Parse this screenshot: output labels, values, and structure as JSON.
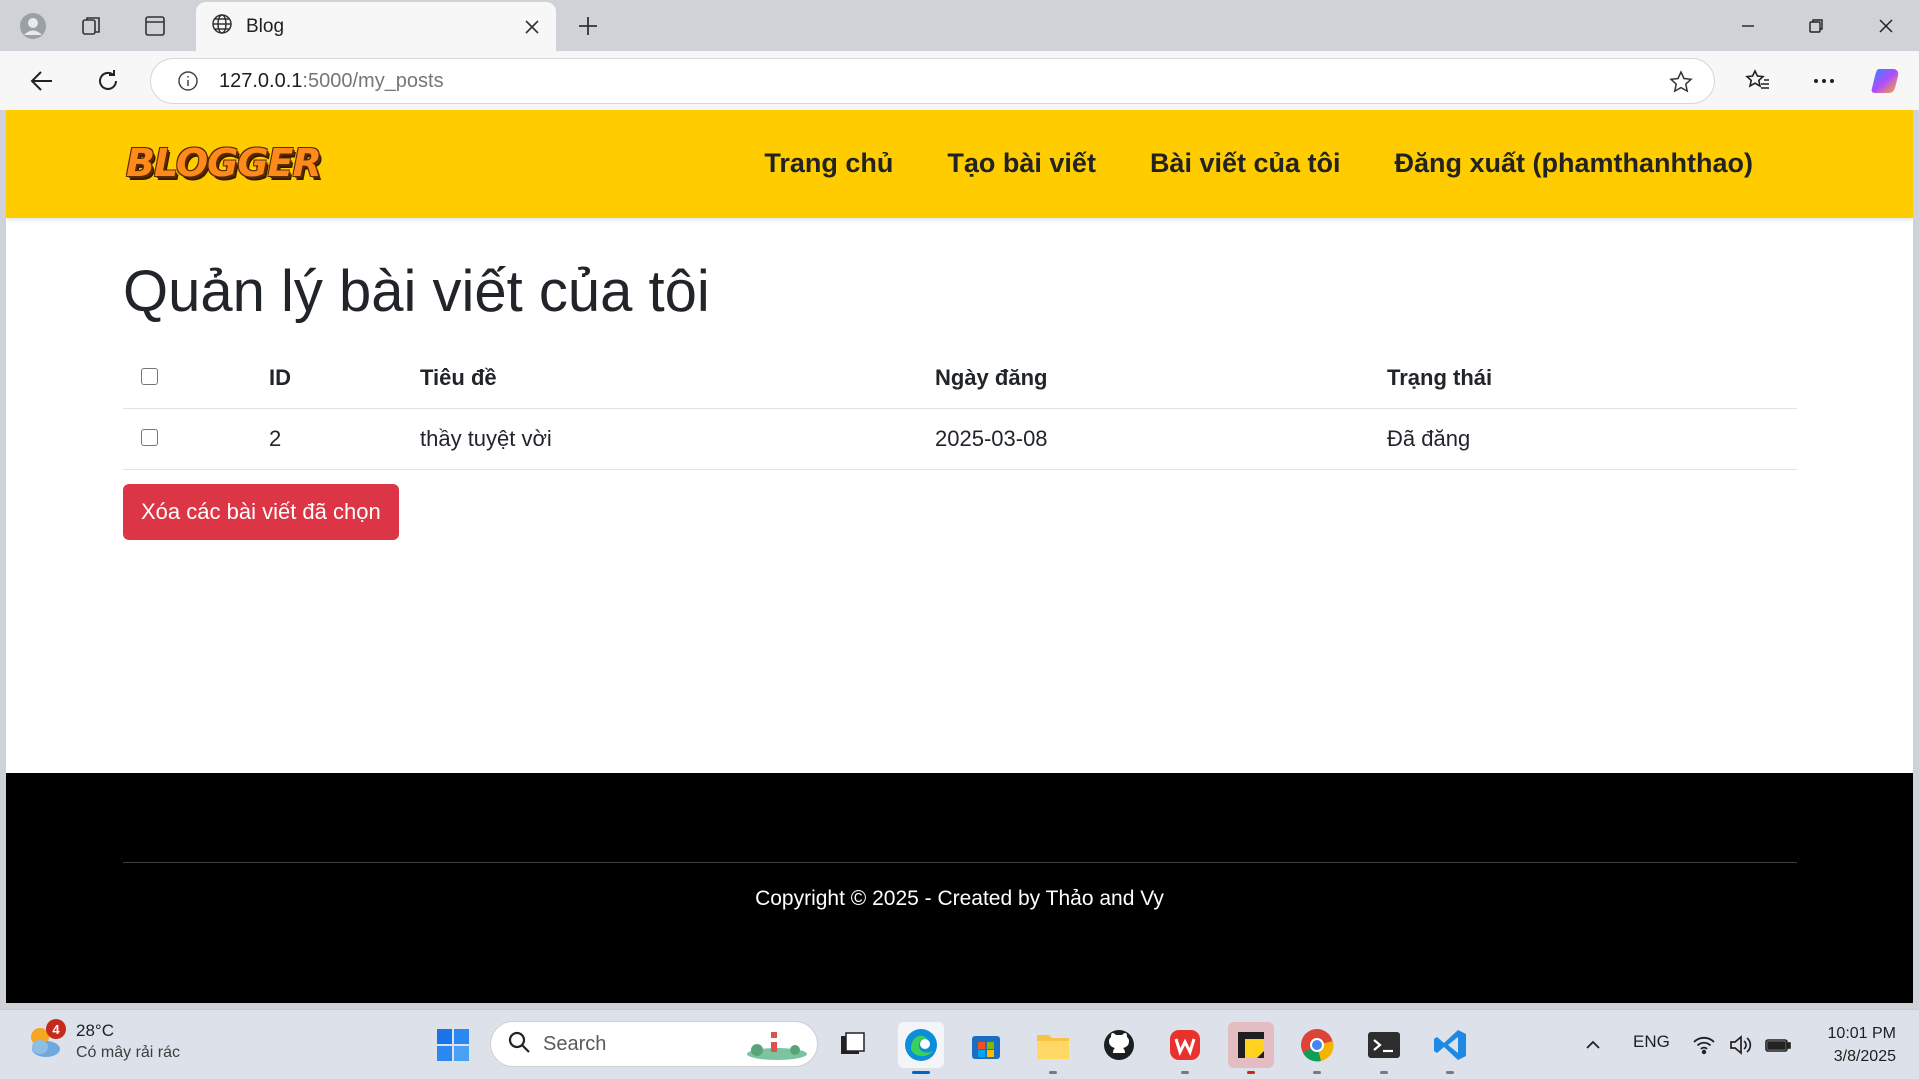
{
  "browser": {
    "tab_title": "Blog",
    "url_host": "127.0.0.1",
    "url_path": ":5000/my_posts"
  },
  "navbar": {
    "logo_text": "BLOGGER",
    "items": [
      {
        "label": "Trang chủ"
      },
      {
        "label": "Tạo bài viết"
      },
      {
        "label": "Bài viết của tôi"
      },
      {
        "label": "Đăng xuất (phamthanhthao)"
      }
    ]
  },
  "main": {
    "heading": "Quản lý bài viết của tôi",
    "table": {
      "headers": {
        "id": "ID",
        "title": "Tiêu đề",
        "date": "Ngày đăng",
        "status": "Trạng thái"
      },
      "rows": [
        {
          "id": "2",
          "title": "thầy tuyệt vời",
          "date": "2025-03-08",
          "status": "Đã đăng"
        }
      ]
    },
    "delete_button": "Xóa các bài viết đã chọn"
  },
  "footer": {
    "copyright": "Copyright © 2025 - Created by Thảo and Vy"
  },
  "taskbar": {
    "weather_temp": "28°C",
    "weather_desc": "Có mây rải rác",
    "weather_badge": "4",
    "search_label": "Search",
    "language": "ENG",
    "time": "10:01 PM",
    "date": "3/8/2025"
  },
  "colors": {
    "navbar_bg": "#ffcc00",
    "danger": "#dc3545",
    "footer_bg": "#000000"
  }
}
